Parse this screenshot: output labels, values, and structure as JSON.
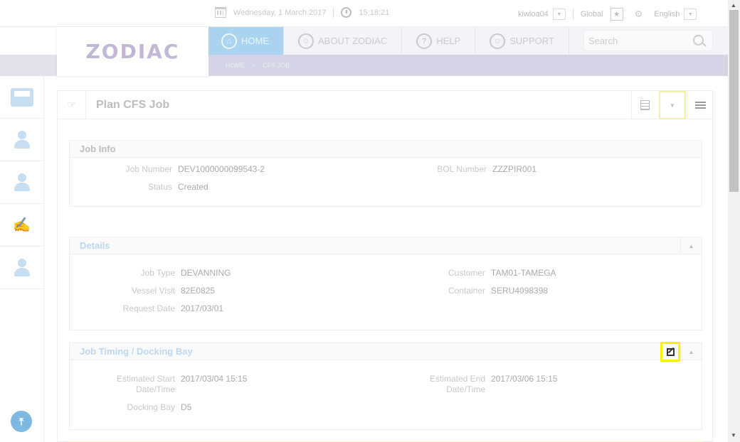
{
  "topbar": {
    "date": "Wednesday, 1 March 2017",
    "time": "15:18:21",
    "user": "kiwloa04",
    "scope": "Global",
    "language": "English"
  },
  "logo": {
    "text": "ZODIAC"
  },
  "nav": {
    "items": [
      {
        "label": "HOME",
        "icon": "home-icon"
      },
      {
        "label": "ABOUT ZODIAC",
        "icon": "people-icon"
      },
      {
        "label": "HELP",
        "icon": "question-icon"
      },
      {
        "label": "SUPPORT",
        "icon": "support-icon"
      }
    ],
    "search_placeholder": "Search"
  },
  "breadcrumb": {
    "home": "HOME",
    "separator": ">",
    "current": "CFS JOB"
  },
  "panel": {
    "title": "Plan CFS Job"
  },
  "job_info": {
    "title": "Job Info",
    "job_number_label": "Job Number",
    "job_number": "DEV1000000099543-2",
    "bol_label": "BOL Number",
    "bol": "ZZZPIR001",
    "status_label": "Status",
    "status": "Created"
  },
  "details": {
    "title": "Details",
    "job_type_label": "Job Type",
    "job_type": "DEVANNING",
    "customer_label": "Customer",
    "customer": "TAM01-TAMEGA",
    "vessel_visit_label": "Vessel Visit",
    "vessel_visit": "82E0825",
    "container_label": "Container",
    "container": "SERU4098398",
    "request_date_label": "Request Date",
    "request_date": "2017/03/01"
  },
  "timing": {
    "title": "Job Timing / Docking Bay",
    "est_start_label_1": "Estimated Start",
    "est_start_label_2": "Date/Time",
    "est_start": "2017/03/04 15:15",
    "est_end_label_1": "Estimated End",
    "est_end_label_2": "Date/Time",
    "est_end": "2017/03/06 15:15",
    "docking_bay_label": "Docking Bay",
    "docking_bay": "D5"
  },
  "colors": {
    "accent": "#a9d3ee",
    "highlight": "#f5f500"
  }
}
